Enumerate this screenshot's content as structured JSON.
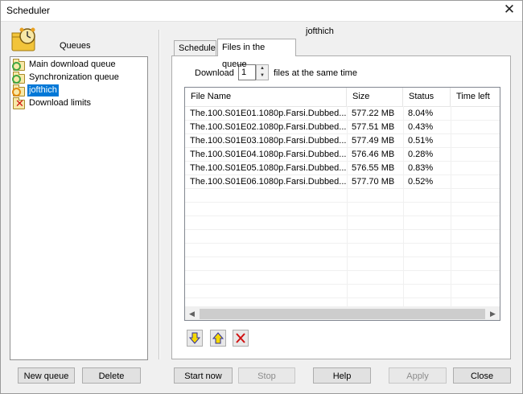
{
  "window": {
    "title": "Scheduler",
    "close_glyph": "✕"
  },
  "left_pane": {
    "title": "Queues",
    "items": [
      {
        "label": "Main download queue",
        "icon": "queue-folder-icon",
        "selected": false
      },
      {
        "label": "Synchronization queue",
        "icon": "queue-folder-icon",
        "selected": false
      },
      {
        "label": "jofthich",
        "icon": "queue-folder-icon",
        "selected": true
      },
      {
        "label": "Download limits",
        "icon": "download-limits-icon",
        "selected": false
      }
    ],
    "new_queue_label": "New queue",
    "delete_label": "Delete"
  },
  "right_pane": {
    "queue_name": "jofthich",
    "tabs": [
      {
        "label": "Schedule",
        "active": false
      },
      {
        "label": "Files in the queue",
        "active": true
      }
    ],
    "download_prefix": "Download",
    "simultaneous_count": "1",
    "download_suffix": "files at the same time",
    "columns": [
      "File Name",
      "Size",
      "Status",
      "Time left"
    ],
    "files": [
      {
        "name": "The.100.S01E01.1080p.Farsi.Dubbed....",
        "size": "577.22  MB",
        "status": "8.04%",
        "time_left": ""
      },
      {
        "name": "The.100.S01E02.1080p.Farsi.Dubbed....",
        "size": "577.51  MB",
        "status": "0.43%",
        "time_left": ""
      },
      {
        "name": "The.100.S01E03.1080p.Farsi.Dubbed....",
        "size": "577.49  MB",
        "status": "0.51%",
        "time_left": ""
      },
      {
        "name": "The.100.S01E04.1080p.Farsi.Dubbed....",
        "size": "576.46  MB",
        "status": "0.28%",
        "time_left": ""
      },
      {
        "name": "The.100.S01E05.1080p.Farsi.Dubbed....",
        "size": "576.55  MB",
        "status": "0.83%",
        "time_left": ""
      },
      {
        "name": "The.100.S01E06.1080p.Farsi.Dubbed....",
        "size": "577.70  MB",
        "status": "0.52%",
        "time_left": ""
      }
    ],
    "actions": {
      "move_down_icon": "arrow-down-icon",
      "move_up_icon": "arrow-up-icon",
      "remove_icon": "red-x-icon"
    }
  },
  "footer": {
    "start_now": "Start now",
    "stop": "Stop",
    "help": "Help",
    "apply": "Apply",
    "close": "Close"
  },
  "colors": {
    "selection": "#0078d7",
    "window_bg": "#f0f0f0",
    "arrow_yellow": "#f5d800",
    "delete_red": "#d01010"
  }
}
